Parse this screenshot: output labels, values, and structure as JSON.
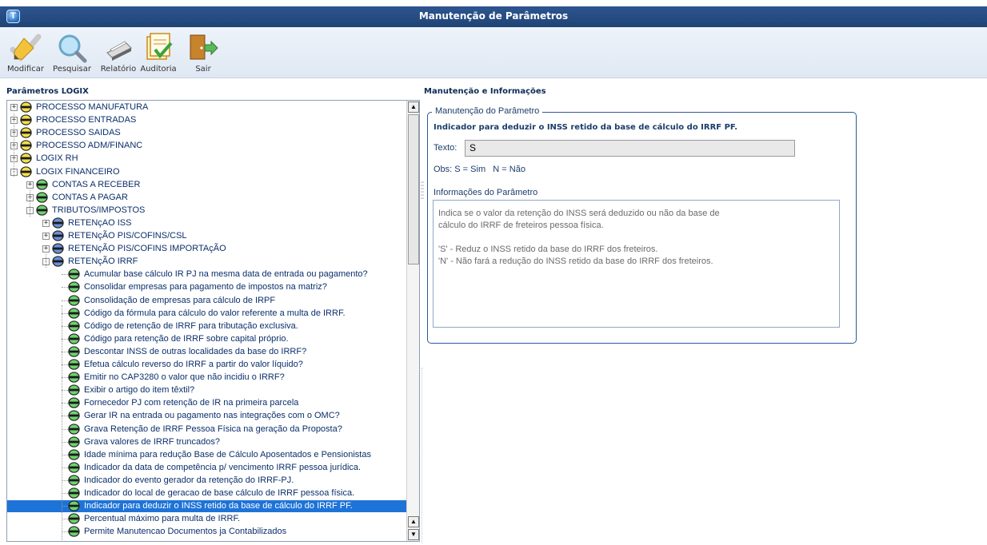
{
  "window": {
    "title": "Manutenção de Parâmetros",
    "logo": "T"
  },
  "toolbar": {
    "modificar": "Modificar",
    "pesquisar": "Pesquisar",
    "relatorio": "Relatório",
    "auditoria": "Auditoria",
    "sair": "Sair"
  },
  "left_section": {
    "title": "Parâmetros LOGIX"
  },
  "right_section": {
    "title": "Manutenção e Informações"
  },
  "tree": {
    "items": [
      "PROCESSO MANUFATURA",
      "PROCESSO ENTRADAS",
      "PROCESSO SAIDAS",
      "PROCESSO ADM/FINANC",
      "LOGIX RH",
      "LOGIX FINANCEIRO",
      "CONTAS A RECEBER",
      "CONTAS A PAGAR",
      "TRIBUTOS/IMPOSTOS",
      "RETENçAO ISS",
      "RETENçÃO PIS/COFINS/CSL",
      "RETENçÃO PIS/COFINS IMPORTAçÃO",
      "RETENçÃO IRRF",
      "Acumular base cálculo IR PJ na mesma data de entrada ou pagamento?",
      "Consolidar empresas para pagamento de impostos na matriz?",
      "Consolidação de empresas para cálculo de IRPF",
      "Código da fórmula para cálculo do valor referente a multa de IRRF.",
      "Código de retenção de IRRF para tributação exclusiva.",
      "Código para retenção de IRRF sobre capital próprio.",
      "Descontar INSS de outras localidades da base do IRRF?",
      "Efetua cálculo reverso do IRRF a partir do valor líquido?",
      "Emitir no CAP3280 o valor que não incidiu o IRRF?",
      "Exibir o artigo do item têxtil?",
      "Fornecedor PJ com retenção de IR na primeira parcela",
      "Gerar IR na entrada ou pagamento nas integrações com o OMC?",
      "Grava Retenção de IRRF Pessoa Física na geração da Proposta?",
      "Grava valores de IRRF truncados?",
      "Idade mínima para redução Base de Cálculo Aposentados e Pensionistas",
      "Indicador da data de competência p/ vencimento IRRF pessoa jurídica.",
      "Indicador do evento gerador da retenção do IRRF-PJ.",
      "Indicador do local de geracao de base cálculo de IRRF pessoa física.",
      "Indicador para deduzir o INSS retido da base de cálculo do IRRF PF.",
      "Percentual máximo para multa de IRRF.",
      "Permite Manutencao Documentos ja Contabilizados"
    ]
  },
  "form": {
    "legend": "Manutenção do Parâmetro",
    "param_title": "Indicador para deduzir o INSS retido da base de cálculo do IRRF PF.",
    "texto_label": "Texto:",
    "texto_value": "S",
    "obs": "Obs: S = Sim   N = Não",
    "info_label": "Informações do Parâmetro",
    "info_lines": [
      "Indica se o valor da retenção do INSS será deduzido ou não da base de",
      "cálculo do IRRF de freteiros pessoa física.",
      "",
      "'S' - Reduz o INSS retido da base do IRRF dos freteiros.",
      "'N' - Não fará a redução do INSS retido da base do IRRF dos freteiros."
    ]
  }
}
